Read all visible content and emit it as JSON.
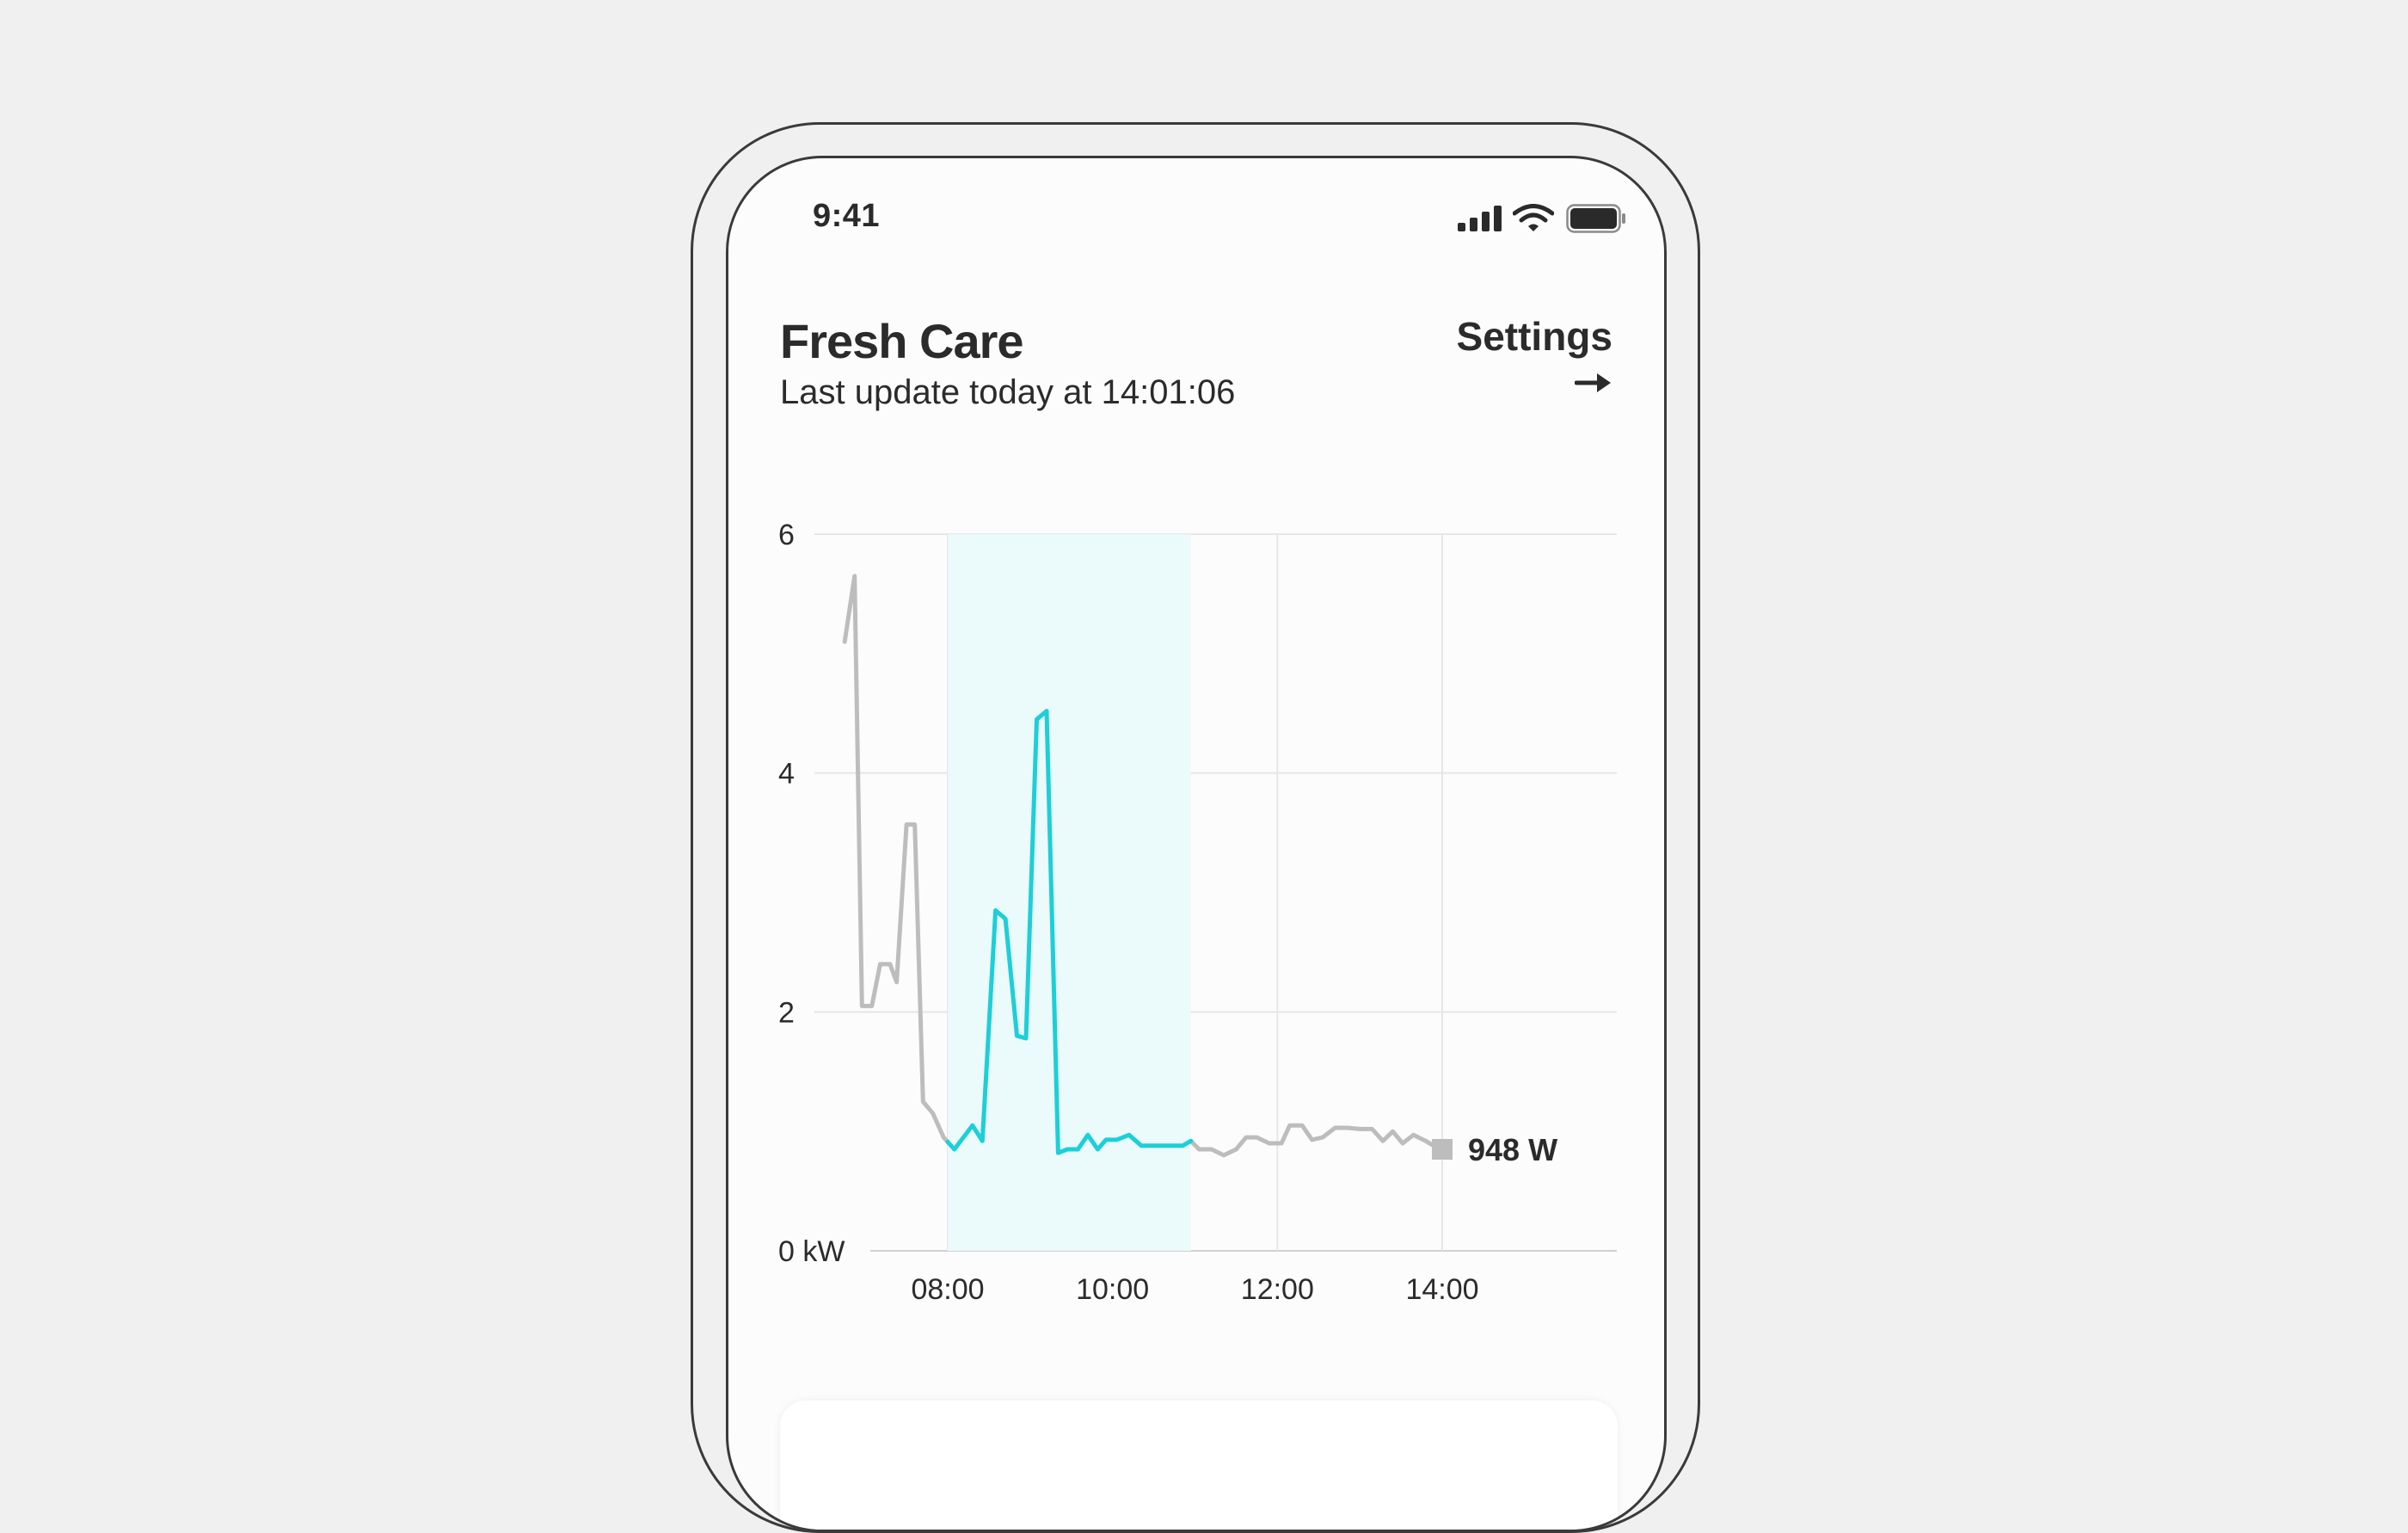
{
  "status_bar": {
    "time": "9:41",
    "signal_icon": "cellular-signal-icon",
    "wifi_icon": "wifi-icon",
    "battery_icon": "battery-icon"
  },
  "header": {
    "title": "Fresh Care",
    "subtitle": "Last update today at 14:01:06",
    "settings_label": "Settings",
    "settings_icon": "arrow-right-icon"
  },
  "colors": {
    "accent": "#1ccfd8",
    "highlight_fill": "#ebfafb",
    "inactive_line": "#bdbdbd",
    "grid": "#e6e6e6",
    "text": "#2b2b2b"
  },
  "chart_data": {
    "type": "line",
    "unit_label": "kW",
    "y_ticks": [
      {
        "value": 0,
        "label": "0 kW"
      },
      {
        "value": 2,
        "label": "2"
      },
      {
        "value": 4,
        "label": "4"
      },
      {
        "value": 6,
        "label": "6"
      }
    ],
    "x_ticks": [
      {
        "value": 8,
        "label": "08:00"
      },
      {
        "value": 10,
        "label": "10:00"
      },
      {
        "value": 12,
        "label": "12:00"
      },
      {
        "value": 14,
        "label": "14:00"
      }
    ],
    "xlim": [
      6.8,
      15.0
    ],
    "ylim": [
      0,
      6
    ],
    "grid": true,
    "highlight_range": [
      8.0,
      10.95
    ],
    "current_value_label": "948 W",
    "current_point": {
      "x": 14.0,
      "y": 0.85
    },
    "series": [
      {
        "points": [
          [
            6.75,
            5.1
          ],
          [
            6.87,
            5.65
          ],
          [
            6.96,
            2.05
          ],
          [
            7.08,
            2.05
          ],
          [
            7.18,
            2.4
          ],
          [
            7.3,
            2.4
          ],
          [
            7.38,
            2.25
          ],
          [
            7.5,
            3.57
          ],
          [
            7.6,
            3.57
          ],
          [
            7.7,
            1.25
          ],
          [
            7.82,
            1.15
          ],
          [
            7.95,
            0.95
          ],
          [
            8.08,
            0.85
          ],
          [
            8.3,
            1.05
          ],
          [
            8.42,
            0.92
          ],
          [
            8.58,
            2.85
          ],
          [
            8.7,
            2.78
          ],
          [
            8.84,
            1.8
          ],
          [
            8.95,
            1.78
          ],
          [
            9.08,
            4.45
          ],
          [
            9.2,
            4.52
          ],
          [
            9.34,
            0.82
          ],
          [
            9.45,
            0.85
          ],
          [
            9.58,
            0.85
          ],
          [
            9.7,
            0.97
          ],
          [
            9.82,
            0.85
          ],
          [
            9.92,
            0.93
          ],
          [
            10.05,
            0.93
          ],
          [
            10.2,
            0.97
          ],
          [
            10.35,
            0.88
          ],
          [
            10.5,
            0.88
          ],
          [
            10.7,
            0.88
          ],
          [
            10.85,
            0.88
          ],
          [
            10.95,
            0.92
          ],
          [
            11.05,
            0.85
          ],
          [
            11.2,
            0.85
          ],
          [
            11.35,
            0.8
          ],
          [
            11.5,
            0.85
          ],
          [
            11.62,
            0.95
          ],
          [
            11.75,
            0.95
          ],
          [
            11.9,
            0.9
          ],
          [
            12.05,
            0.9
          ],
          [
            12.15,
            1.05
          ],
          [
            12.3,
            1.05
          ],
          [
            12.42,
            0.93
          ],
          [
            12.55,
            0.95
          ],
          [
            12.7,
            1.03
          ],
          [
            12.85,
            1.03
          ],
          [
            13.0,
            1.02
          ],
          [
            13.15,
            1.02
          ],
          [
            13.28,
            0.92
          ],
          [
            13.4,
            1.0
          ],
          [
            13.52,
            0.9
          ],
          [
            13.65,
            0.97
          ],
          [
            13.8,
            0.92
          ],
          [
            13.92,
            0.87
          ],
          [
            14.0,
            0.85
          ]
        ]
      }
    ]
  }
}
